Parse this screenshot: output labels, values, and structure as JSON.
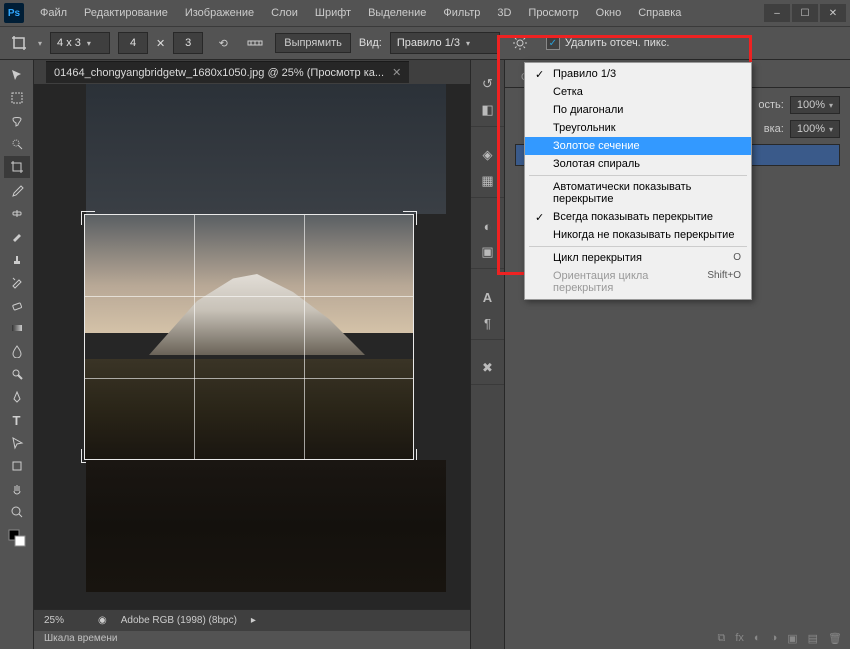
{
  "app": {
    "logo": "Ps"
  },
  "menu": [
    "Файл",
    "Редактирование",
    "Изображение",
    "Слои",
    "Шрифт",
    "Выделение",
    "Фильтр",
    "3D",
    "Просмотр",
    "Окно",
    "Справка"
  ],
  "options": {
    "ratio_preset": "4 x 3",
    "w": "4",
    "h": "3",
    "straighten": "Выпрямить",
    "view_label": "Вид:",
    "view_value": "Правило 1/3",
    "delete_px": "Удалить отсеч. пикс."
  },
  "doc_tab": {
    "title": "01464_chongyangbridgetw_1680x1050.jpg @ 25% (Просмотр ка..."
  },
  "status": {
    "zoom": "25%",
    "profile": "Adobe RGB (1998) (8bpc)"
  },
  "timeline": "Шкала времени",
  "panel_right": {
    "opacity_label": "ость:",
    "opacity_val": "100%",
    "fill_label": "вка:",
    "fill_val": "100%"
  },
  "overlay_menu": {
    "items_g1": [
      "Правило 1/3",
      "Сетка",
      "По диагонали",
      "Треугольник",
      "Золотое сечение",
      "Золотая спираль"
    ],
    "checked_g1": "Правило 1/3",
    "highlighted": "Золотое сечение",
    "items_g2": [
      "Автоматически показывать перекрытие",
      "Всегда показывать перекрытие",
      "Никогда не показывать перекрытие"
    ],
    "checked_g2": "Всегда показывать перекрытие",
    "items_g3": [
      {
        "label": "Цикл перекрытия",
        "shortcut": "O",
        "disabled": false
      },
      {
        "label": "Ориентация цикла перекрытия",
        "shortcut": "Shift+O",
        "disabled": true
      }
    ]
  }
}
